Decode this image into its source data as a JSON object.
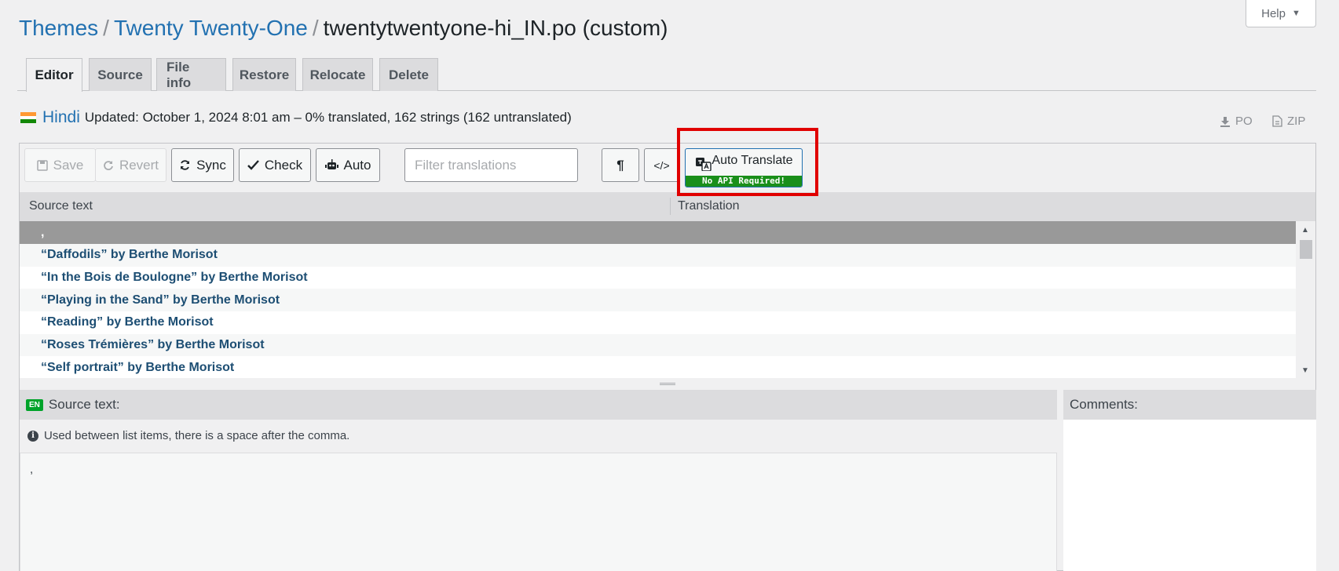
{
  "help": {
    "label": "Help",
    "arrow": "▼"
  },
  "breadcrumb": {
    "themes": "Themes",
    "sep": "/",
    "theme": "Twenty Twenty-One",
    "file": "twentytwentyone-hi_IN.po (custom)"
  },
  "tabs": [
    {
      "label": "Editor"
    },
    {
      "label": "Source"
    },
    {
      "label": "File info"
    },
    {
      "label": "Restore"
    },
    {
      "label": "Relocate"
    },
    {
      "label": "Delete"
    }
  ],
  "language": {
    "name": "Hindi",
    "status": "Updated: October 1, 2024 8:01 am – 0% translated, 162 strings (162 untranslated)"
  },
  "downloads": {
    "po": "PO",
    "zip": "ZIP"
  },
  "toolbar": {
    "save": "Save",
    "revert": "Revert",
    "sync": "Sync",
    "check": "Check",
    "auto": "Auto",
    "filter_placeholder": "Filter translations",
    "pilcrow": "¶",
    "code": "</>",
    "auto_translate": "Auto Translate",
    "auto_translate_badge": "No API Required!"
  },
  "grid": {
    "source_header": "Source text",
    "translation_header": "Translation",
    "rows": [
      ",",
      "“Daffodils” by Berthe Morisot",
      "“In the Bois de Boulogne” by Berthe Morisot",
      "“Playing in the Sand” by Berthe Morisot",
      "“Reading” by Berthe Morisot",
      "“Roses Trémières” by Berthe Morisot",
      "“Self portrait” by Berthe Morisot"
    ]
  },
  "source_pane": {
    "badge": "EN",
    "title": "Source text:",
    "note": "Used between list items, there is a space after the comma.",
    "text": ","
  },
  "comments": {
    "title": "Comments:"
  },
  "colors": {
    "accent": "#2271b1",
    "highlight": "#e00000",
    "badge_green": "#1a8f1a"
  }
}
